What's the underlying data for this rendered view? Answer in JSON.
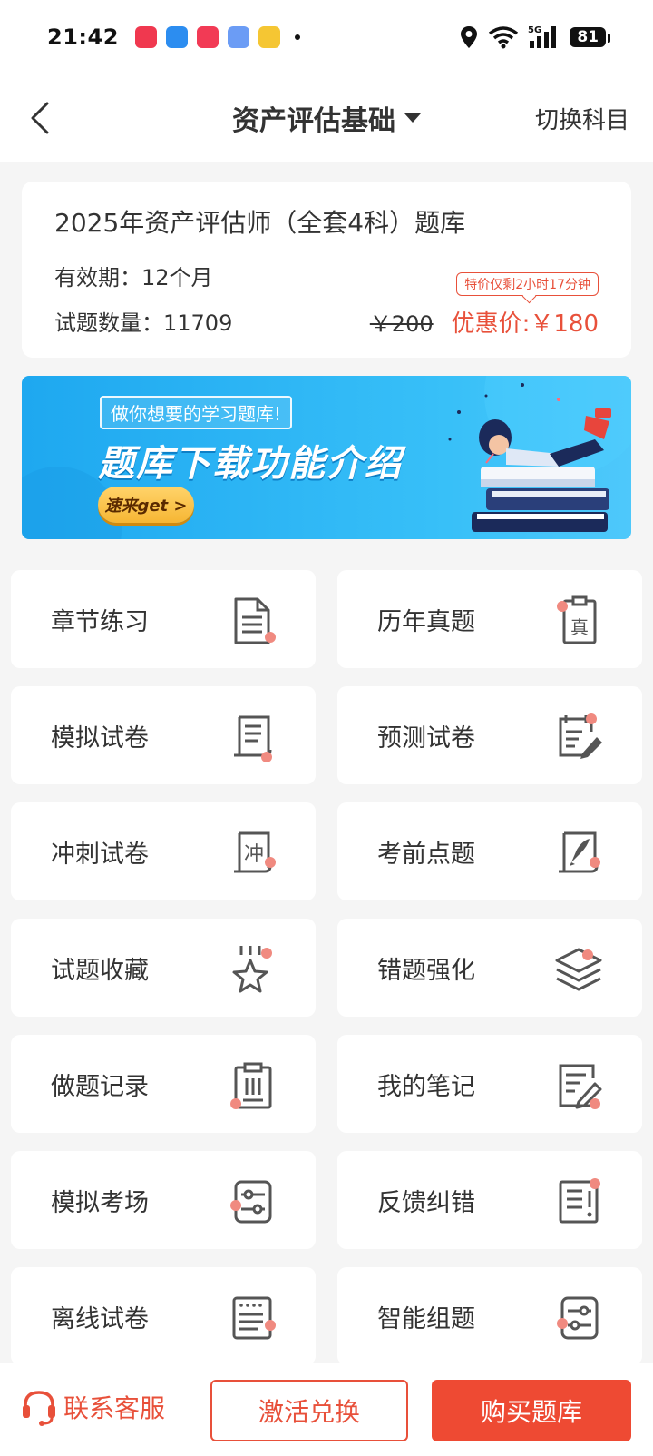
{
  "status_bar": {
    "time": "21:42",
    "network": "5G",
    "battery": "81"
  },
  "nav": {
    "title": "资产评估基础",
    "switch_label": "切换科目"
  },
  "package": {
    "title": "2025年资产评估师（全套4科）题库",
    "validity": "有效期：12个月",
    "question_count": "试题数量：11709",
    "promo_tag": "特价仅剩2小时17分钟",
    "old_price": "￥200",
    "new_price": "优惠价:￥180"
  },
  "banner": {
    "subtitle": "做你想要的学习题库!",
    "headline": "题库下载功能介绍",
    "cta": "速来get >"
  },
  "tiles": [
    {
      "label": "章节练习",
      "icon": "document-icon"
    },
    {
      "label": "历年真题",
      "icon": "past-exam-icon"
    },
    {
      "label": "模拟试卷",
      "icon": "scroll-icon"
    },
    {
      "label": "预测试卷",
      "icon": "edit-list-icon"
    },
    {
      "label": "冲刺试卷",
      "icon": "sprint-scroll-icon"
    },
    {
      "label": "考前点题",
      "icon": "rocket-board-icon"
    },
    {
      "label": "试题收藏",
      "icon": "star-icon"
    },
    {
      "label": "错题强化",
      "icon": "layers-icon"
    },
    {
      "label": "做题记录",
      "icon": "clipboard-icon"
    },
    {
      "label": "我的笔记",
      "icon": "note-pen-icon"
    },
    {
      "label": "模拟考场",
      "icon": "slider-settings-icon"
    },
    {
      "label": "反馈纠错",
      "icon": "feedback-icon"
    },
    {
      "label": "离线试卷",
      "icon": "offline-paper-icon"
    },
    {
      "label": "智能组题",
      "icon": "smart-compose-icon"
    }
  ],
  "bottom": {
    "service_label": "联系客服",
    "activate_label": "激活兑换",
    "buy_label": "购买题库"
  },
  "colors": {
    "accent": "#ee4a33",
    "accent_text": "#e8503a",
    "icon_dot": "#f08a80",
    "icon_stroke": "#555555"
  }
}
